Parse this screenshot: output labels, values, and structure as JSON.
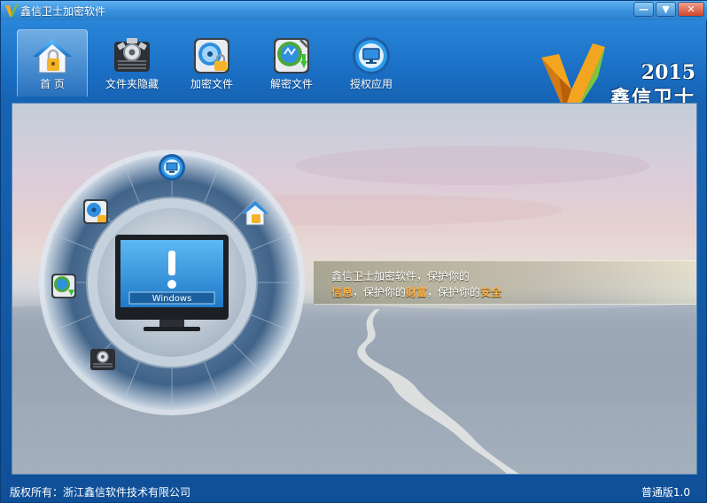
{
  "window": {
    "title": "鑫信卫士加密软件",
    "minimize_label": "—",
    "menu_label": "▼",
    "close_label": "✕"
  },
  "toolbar": {
    "tabs": [
      {
        "label": "首 页",
        "icon": "home-lock-icon",
        "active": true
      },
      {
        "label": "文件夹隐藏",
        "icon": "folder-hide-icon",
        "active": false
      },
      {
        "label": "加密文件",
        "icon": "disk-lock-icon",
        "active": false
      },
      {
        "label": "解密文件",
        "icon": "decrypt-icon",
        "active": false
      },
      {
        "label": "授权应用",
        "icon": "monitor-icon",
        "active": false
      }
    ]
  },
  "brand": {
    "year": "2015",
    "name": "鑫信卫士"
  },
  "main": {
    "screen_label": "Windows",
    "slogan_line1": "鑫信卫士加密软件，保护你的",
    "slogan_line2": {
      "w1": "信息",
      "t1": "，保护你的",
      "w2": "财富",
      "t2": "，保护你的",
      "w3": "安全"
    }
  },
  "status": {
    "copyright": "版权所有：浙江鑫信软件技术有限公司",
    "version": "普通版1.0"
  },
  "colors": {
    "accent": "#1a6fc4",
    "highlight": "#ffb347"
  }
}
